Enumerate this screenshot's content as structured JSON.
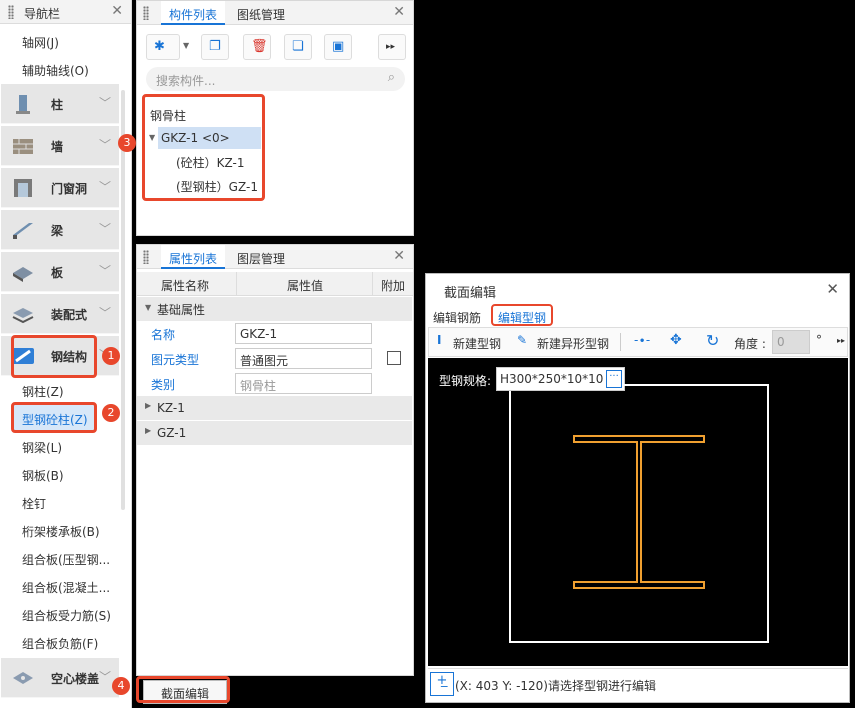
{
  "nav": {
    "title": "导航栏",
    "sub_top": [
      "轴网(J)",
      "辅助轴线(O)"
    ],
    "categories": [
      "柱",
      "墙",
      "门窗洞",
      "梁",
      "板",
      "装配式",
      "钢结构"
    ],
    "steel_items": [
      "钢柱(Z)",
      "型钢砼柱(Z)",
      "钢梁(L)",
      "钢板(B)",
      "栓钉",
      "桁架楼承板(B)",
      "组合板(压型钢...",
      "组合板(混凝土...",
      "组合板受力筋(S)",
      "组合板负筋(F)"
    ],
    "bottom_cat": "空心楼盖"
  },
  "components": {
    "tab_active": "构件列表",
    "tab2": "图纸管理",
    "search_placeholder": "搜索构件...",
    "tree_root": "钢骨柱",
    "tree_node": "GKZ-1 <0>",
    "tree_children": [
      "(砼柱）KZ-1",
      "(型钢柱）GZ-1"
    ]
  },
  "props": {
    "tab_active": "属性列表",
    "tab2": "图层管理",
    "col_name": "属性名称",
    "col_value": "属性值",
    "col_add": "附加",
    "group": "基础属性",
    "rows": [
      {
        "name": "名称",
        "value": "GKZ-1"
      },
      {
        "name": "图元类型",
        "value": "普通图元"
      },
      {
        "name": "类别",
        "value": "钢骨柱"
      }
    ],
    "sub_groups": [
      "KZ-1",
      "GZ-1"
    ],
    "section_btn": "截面编辑"
  },
  "editor": {
    "title": "截面编辑",
    "tab1": "编辑钢筋",
    "tab2": "编辑型钢",
    "btn_new": "新建型钢",
    "btn_new_special": "新建异形型钢",
    "angle_label": "角度 :",
    "angle_value": "0",
    "degree": "°",
    "spec_label": "型钢规格:",
    "spec_value": "H300*250*10*10",
    "status": "(X: 403 Y: -120)请选择型钢进行编辑"
  },
  "badges": [
    "1",
    "2",
    "3",
    "4"
  ],
  "colors": {
    "accent": "#1874d6",
    "highlight": "#e8472c",
    "steel": "#f0a030"
  }
}
